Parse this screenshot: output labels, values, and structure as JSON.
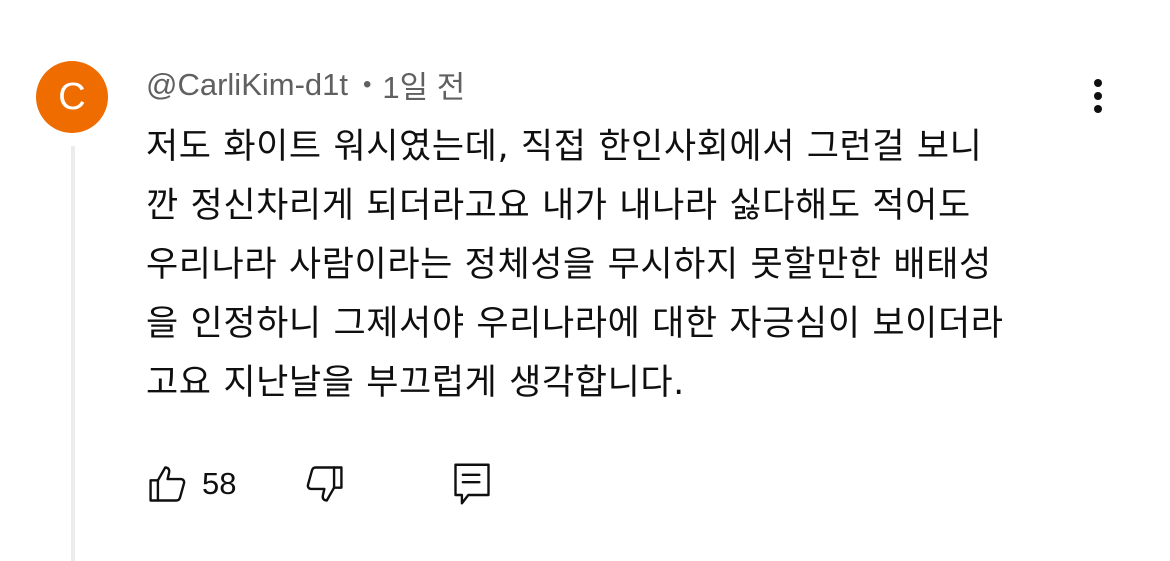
{
  "comment": {
    "avatar_letter": "C",
    "avatar_color": "#ef6c00",
    "author": "@CarliKim-d1t",
    "separator": "•",
    "timestamp": "1일 전",
    "text_lines": [
      "저도 화이트 워시였는데, 직접 한인사회에서 그런걸 보니",
      "깐 정신차리게 되더라고요 내가 내나라 싫다해도 적어도",
      "우리나라 사람이라는 정체성을 무시하지 못할만한 배태성",
      "을 인정하니 그제서야 우리나라에 대한 자긍심이 보이더라",
      "고요 지난날을 부끄럽게 생각합니다."
    ],
    "like_count": "58",
    "icons": {
      "like": "thumbs-up-icon",
      "dislike": "thumbs-down-icon",
      "reply": "reply-icon",
      "more": "more-vertical-icon"
    }
  }
}
